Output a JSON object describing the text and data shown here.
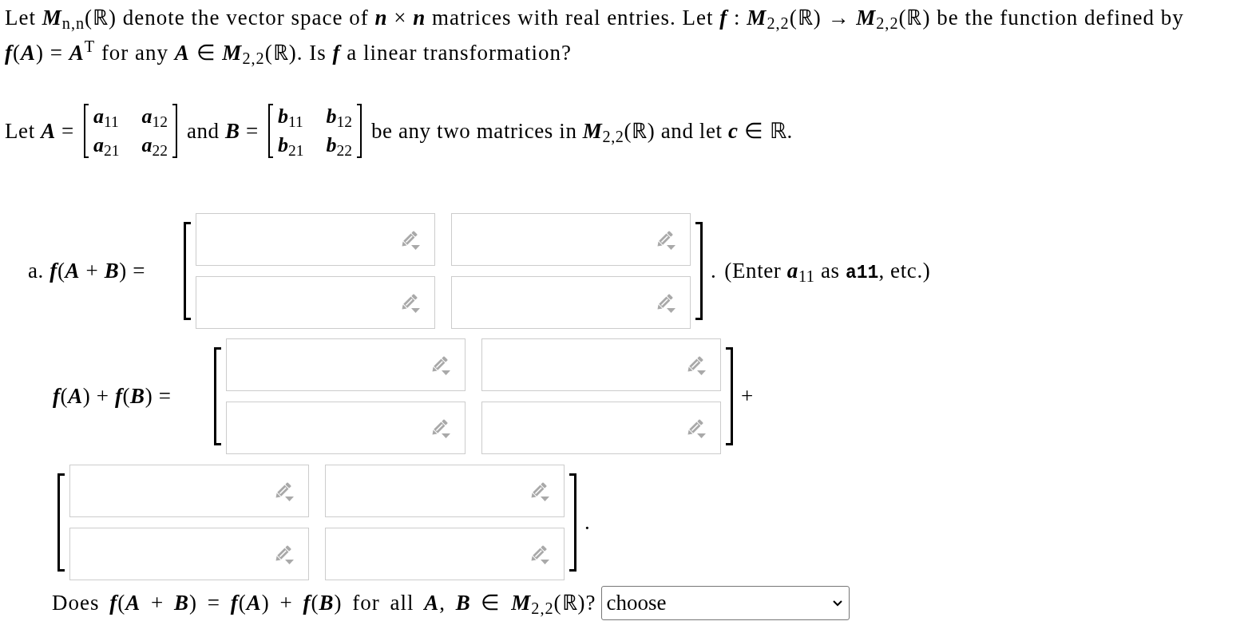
{
  "question": {
    "text": "Let *M*$_{n,n}$(ℝ) denote the vector space of *n* × *n* matrices with real entries. Let *f* : *M*$_{2,2}$(ℝ) → *M*$_{2,2}$(ℝ) be the function defined by *f*(*A*) = *A*$^{T}$ for any *A* ∈ *M*$_{2,2}$(ℝ). Is *f* a linear transformation?"
  },
  "setup": {
    "lead": "Let *A* =",
    "matrix_a": [
      [
        "*a*$_{11}$",
        "*a*$_{12}$"
      ],
      [
        "*a*$_{21}$",
        "*a*$_{22}$"
      ]
    ],
    "middle": "and *B* =",
    "matrix_b": [
      [
        "*b*$_{11}$",
        "*b*$_{12}$"
      ],
      [
        "*b*$_{21}$",
        "*b*$_{22}$"
      ]
    ],
    "tail": "be any two matrices in *M*$_{2,2}$(ℝ) and let *c* ∈ ℝ."
  },
  "answers": [
    {
      "label": "a. *f*(*A* + *B*) =",
      "cells": [
        [
          {
            "kind": "entry"
          },
          {
            "kind": "entry"
          }
        ],
        [
          {
            "kind": "entry"
          },
          {
            "kind": "entry"
          }
        ]
      ],
      "after": ".",
      "hint": {
        "before": "(Enter *a*$_{11}$ as",
        "code": "a11",
        "after": ", etc.)"
      }
    },
    {
      "label": "*f*(*A*) + *f*(*B*) =",
      "cells": [
        [
          {
            "kind": "entry"
          },
          {
            "kind": "entry"
          }
        ],
        [
          {
            "kind": "entry"
          },
          {
            "kind": "entry"
          }
        ]
      ],
      "after": "+"
    },
    {
      "cells": [
        [
          {
            "kind": "entry"
          },
          {
            "kind": "entry"
          }
        ],
        [
          {
            "kind": "entry"
          },
          {
            "kind": "entry"
          }
        ]
      ],
      "after": "."
    }
  ],
  "final_question": {
    "text": "Does *f*(*A* + *B*) = *f*(*A*) + *f*(*B*) for all *A*, *B* ∈ *M*$_{2,2}$(ℝ)?",
    "select": {
      "value": "choose"
    }
  }
}
